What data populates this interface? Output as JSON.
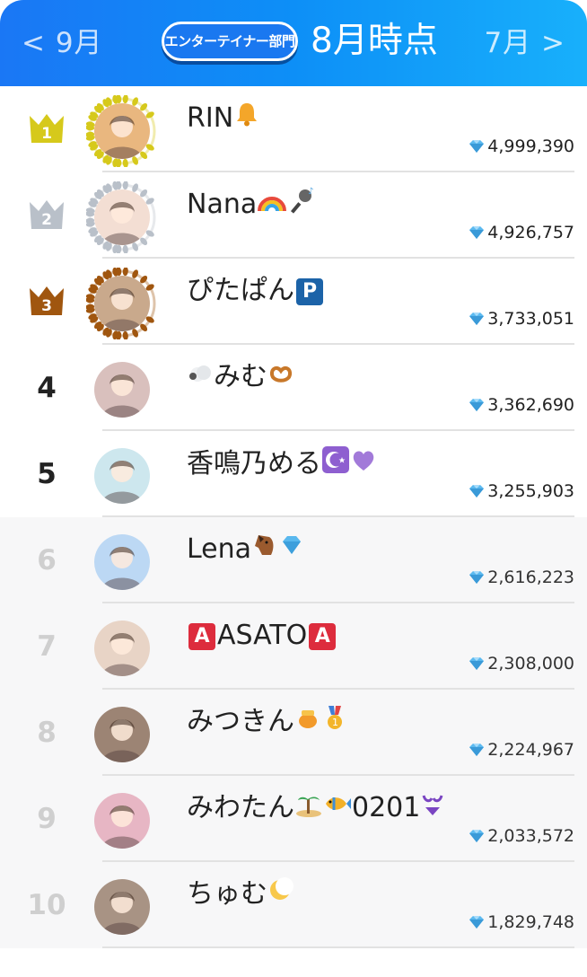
{
  "header": {
    "prev_label": "< 9月",
    "next_label": "7月 >",
    "badge_label": "エンターテイナー部門",
    "title": "8月時点",
    "colors": {
      "gradient_start": "#1a77f5",
      "gradient_end": "#18b0fb"
    }
  },
  "colors": {
    "gold": "#d6c91b",
    "silver": "#b9c0c9",
    "bronze": "#a0560f",
    "gem": "#4fb6f2"
  },
  "rows": [
    {
      "rank": "1",
      "medal": "gold",
      "name": "RIN",
      "suffix_icons": [
        "bell-icon"
      ],
      "score": "4,999,390",
      "avatar_tint": "#e9b77f"
    },
    {
      "rank": "2",
      "medal": "silver",
      "name": "Nana",
      "suffix_icons": [
        "rainbow-icon",
        "microphone-icon"
      ],
      "score": "4,926,757",
      "avatar_tint": "#f3ded3"
    },
    {
      "rank": "3",
      "medal": "bronze",
      "name": "ぴたぱん",
      "suffix_icons": [
        "parking-sign-icon"
      ],
      "score": "3,733,051",
      "avatar_tint": "#c9a98c"
    },
    {
      "rank": "4",
      "medal": "",
      "name": "みむ",
      "prefix_icons": [
        "sheep-icon"
      ],
      "suffix_icons": [
        "pretzel-icon"
      ],
      "score": "3,362,690",
      "avatar_tint": "#d9c0bd"
    },
    {
      "rank": "5",
      "medal": "",
      "name": "香鳴乃める",
      "suffix_icons": [
        "star-and-crescent-icon",
        "purple-heart-icon"
      ],
      "score": "3,255,903",
      "avatar_tint": "#cde7ee"
    },
    {
      "rank": "6",
      "medal": "",
      "name": "Lena",
      "suffix_icons": [
        "horse-face-icon",
        "gem-icon"
      ],
      "score": "2,616,223",
      "avatar_tint": "#bcd8f4"
    },
    {
      "rank": "7",
      "medal": "",
      "name": "ASATO",
      "prefix_icons": [
        "a-button-icon"
      ],
      "suffix_icons": [
        "a-button-icon"
      ],
      "score": "2,308,000",
      "avatar_tint": "#e8d4c6"
    },
    {
      "rank": "8",
      "medal": "",
      "name": "みつきん",
      "suffix_icons": [
        "honey-pot-icon",
        "first-place-medal-icon"
      ],
      "score": "2,224,967",
      "avatar_tint": "#9c8474"
    },
    {
      "rank": "9",
      "medal": "",
      "name": "みわたん",
      "suffix_icons": [
        "island-icon",
        "tropical-fish-icon"
      ],
      "name_tail": "0201",
      "tail_icons": [
        "bikini-icon"
      ],
      "score": "2,033,572",
      "avatar_tint": "#e7b6c4"
    },
    {
      "rank": "10",
      "medal": "",
      "name": "ちゅむ",
      "suffix_icons": [
        "crescent-moon-icon"
      ],
      "score": "1,829,748",
      "avatar_tint": "#a89384"
    }
  ]
}
